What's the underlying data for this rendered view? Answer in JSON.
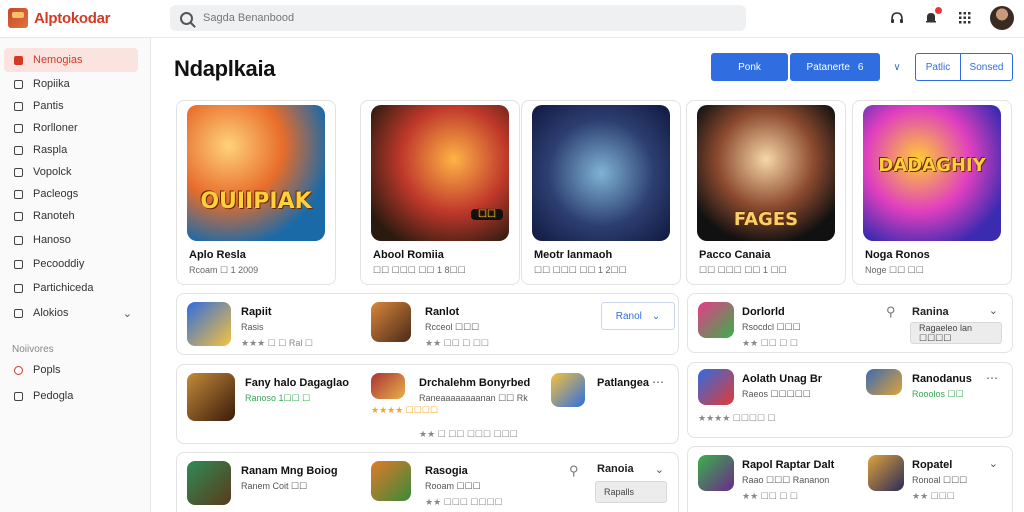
{
  "app": {
    "title": "Alptokodar"
  },
  "search": {
    "placeholder": "Sagda Benanbood"
  },
  "sidebar": {
    "items": [
      {
        "label": "Nemogias",
        "active": true
      },
      {
        "label": "Ropiika"
      },
      {
        "label": "Pantis"
      },
      {
        "label": "Rorlloner"
      },
      {
        "label": "Raspla"
      },
      {
        "label": "Vopolck"
      },
      {
        "label": "Pacleogs"
      },
      {
        "label": "Ranoteh"
      },
      {
        "label": "Hanoso"
      },
      {
        "label": "Pecooddiy"
      },
      {
        "label": "Partichiceda"
      },
      {
        "label": "Alokios"
      }
    ],
    "section_label": "Noiivores",
    "sub_items": [
      {
        "label": "Popls"
      },
      {
        "label": "Pedogla"
      }
    ]
  },
  "main": {
    "title": "Ndaplkaia",
    "buttons": {
      "primary": "Ponk",
      "secondary": "Patanerte",
      "secondary_suffix": "6",
      "chevron": "∨",
      "outline1": "Patlic",
      "outline2": "Sonsed"
    }
  },
  "featured": [
    {
      "title": "Aplo Resla",
      "sub": "Rcoam  ☐ 1 2009",
      "art_text": "OUIIPIAK"
    },
    {
      "title": "Abool Romiia",
      "sub": "☐☐ ☐☐☐  ☐☐ 1 8☐☐",
      "art_text": "☐☐"
    },
    {
      "title": "Meotr lanmaoh",
      "sub": "☐☐ ☐☐☐  ☐☐ 1 2☐☐",
      "art_text": ""
    },
    {
      "title": "Pacco Canaia",
      "sub": "☐☐ ☐☐☐  ☐☐ 1 ☐☐",
      "art_text": "FAGES"
    },
    {
      "title": "Noga Ronos",
      "sub": "Noge  ☐☐ ☐☐",
      "art_text": "DADAGHIY"
    }
  ],
  "list_left": [
    {
      "name": "Rapiit",
      "meta": "Rasis",
      "rating": "★★★ ☐ ☐ Ral ☐",
      "chip": "Ranol"
    },
    {
      "name": "Ranlot",
      "meta": "Rcceol ☐☐☐",
      "rating": "★★ ☐☐ ☐ ☐☐"
    },
    {
      "name": "Fany halo Dagaglao",
      "meta": "Ranoso 1☐☐ ☐",
      "rating": "★★★★ ☐☐☐☐"
    },
    {
      "name": "Drchalehm Bonyrbed",
      "meta": "Raneaaaaaaaanan ☐☐ Rk",
      "rating": "★★ ☐ ☐☐ ☐☐☐ ☐☐☐"
    },
    {
      "name": "Patlangea",
      "meta": ""
    },
    {
      "name": "Ranam Mng Boiog",
      "meta": "Ranem Coit ☐☐",
      "rating": ""
    },
    {
      "name": "Rasogia",
      "meta": "Rooam ☐☐☐",
      "rating": "★★ ☐☐☐ ☐☐☐☐"
    },
    {
      "name": "Ranoia",
      "meta": "",
      "chip": "Rapalls"
    }
  ],
  "list_right": [
    {
      "name": "Dorlorld",
      "meta": "Rsocdcl ☐☐☐",
      "rating": "★★ ☐☐ ☐ ☐"
    },
    {
      "name": "Ranina",
      "chip": "Ragaeleo lan ☐☐☐☐"
    },
    {
      "name": "Aolath Unag Br",
      "meta": "Raeos ☐☐☐☐☐",
      "rating": "★★★★ ☐☐☐☐ ☐"
    },
    {
      "name": "Ranodanus",
      "meta": "Rooolos ☐☐"
    },
    {
      "name": "Rapol Raptar Dalt",
      "meta": "Raao ☐☐☐ Rananon",
      "rating": "★★ ☐☐ ☐ ☐"
    },
    {
      "name": "Ropatel",
      "meta": "Ronoal ☐☐☐",
      "rating": "★★ ☐☐☐"
    }
  ],
  "colors": {
    "accent": "#2f6de0",
    "brand": "#d33a26",
    "active_bg": "#fbe3e0"
  },
  "icons": [
    "search-icon",
    "headset-icon",
    "bell-icon",
    "grid-icon",
    "user-avatar"
  ]
}
